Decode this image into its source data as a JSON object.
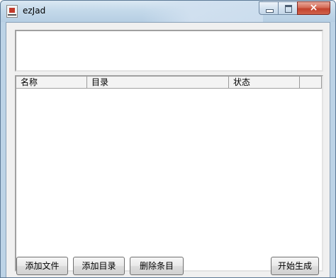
{
  "window": {
    "title": "ezJad",
    "icon": "app-icon",
    "controls": {
      "minimize": "minimize-icon",
      "maximize": "maximize-icon",
      "close": "×"
    }
  },
  "text_area": {
    "value": ""
  },
  "list": {
    "columns": [
      "名称",
      "目录",
      "状态",
      ""
    ],
    "rows": []
  },
  "buttons": {
    "add_file": "添加文件",
    "add_dir": "添加目录",
    "delete_entry": "删除条目",
    "start_generate": "开始生成"
  }
}
